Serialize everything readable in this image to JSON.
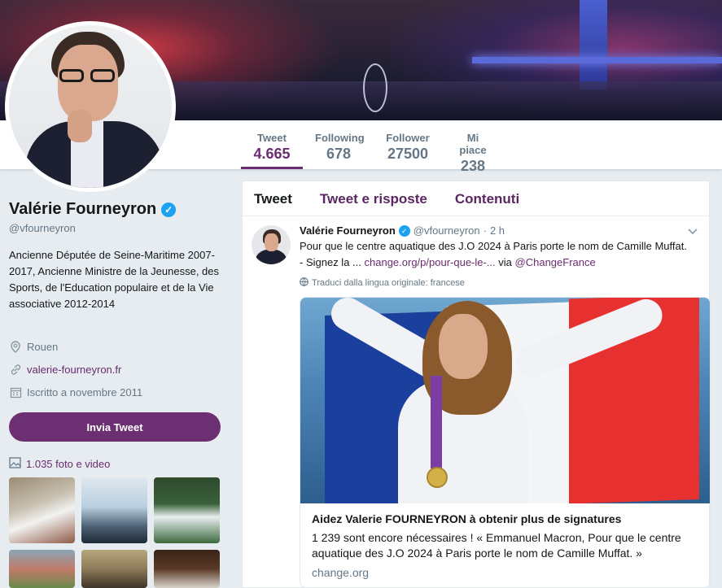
{
  "profile": {
    "name": "Valérie Fourneyron",
    "handle": "@vfourneyron",
    "bio": "Ancienne Députée de Seine-Maritime 2007-2017, Ancienne Ministre de la Jeunesse, des Sports, de l'Education populaire et de la Vie associative 2012-2014",
    "location": "Rouen",
    "website": "valerie-fourneyron.fr",
    "joined": "Iscritto a novembre 2011",
    "tweet_button": "Invia Tweet",
    "media_link": "1.035 foto e video"
  },
  "stats": [
    {
      "label": "Tweet",
      "value": "4.665"
    },
    {
      "label": "Following",
      "value": "678"
    },
    {
      "label": "Follower",
      "value": "27500"
    },
    {
      "label": "Mi piace",
      "value": "238"
    }
  ],
  "tabs": [
    "Tweet",
    "Tweet e risposte",
    "Contenuti"
  ],
  "tweet": {
    "name": "Valérie Fourneyron",
    "handle": "@vfourneyron",
    "sep": "·",
    "time": "2 h",
    "text_plain": "Pour que le centre aquatique des J.O 2024 à Paris porte le nom de  Camille Muffat. - Signez la ...",
    "text_link": "change.org/p/pour-que-le-...",
    "text_via": "via",
    "text_mention": "@ChangeFrance",
    "translate": "Traduci dalla lingua originale: francese",
    "card": {
      "title": "Aidez Valerie FOURNEYRON à obtenir plus de signatures",
      "description": "1 239 sont encore nécessaires ! « Emmanuel Macron, Pour que le centre aquatique des J.O 2024 à Paris porte le nom de Camille Muffat. »",
      "url": "change.org"
    }
  },
  "colors": {
    "accent": "#6a2c70",
    "button": "#6b2f72",
    "verified": "#1da1f2",
    "background": "#e6ecf0"
  },
  "icons": {
    "verified": "verified-badge-icon",
    "location": "location-pin-icon",
    "link": "link-icon",
    "calendar": "calendar-icon",
    "media": "photo-icon",
    "globe": "globe-icon",
    "caret": "chevron-down-icon"
  }
}
